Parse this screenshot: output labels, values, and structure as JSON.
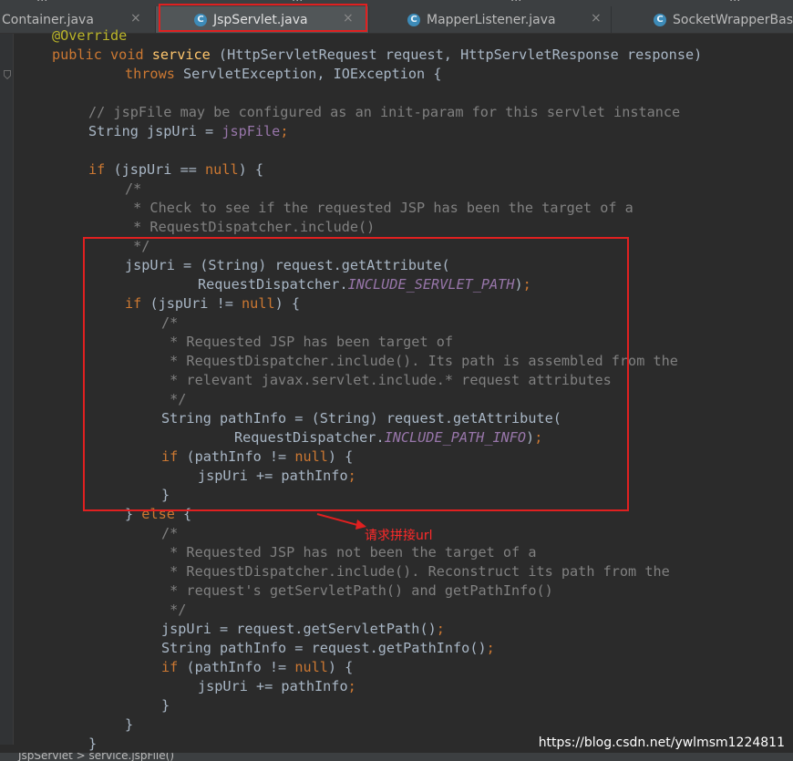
{
  "tabs": [
    {
      "label": "Container.java",
      "active": false
    },
    {
      "label": "JspServlet.java",
      "active": true
    },
    {
      "label": "MapperListener.java",
      "active": false
    },
    {
      "label": "SocketWrapperBase",
      "active": false
    }
  ],
  "tab_icon_letter": "C",
  "close_glyph": "×",
  "ghost_tabs": [
    "...",
    "...",
    "...",
    "..."
  ],
  "code": {
    "l0": {
      "ann": "@Override"
    },
    "l1": {
      "public": "public",
      "void": "void",
      "name": "service",
      "params": " (HttpServletRequest request, HttpServletResponse response)"
    },
    "l2": {
      "throws": "throws",
      "rest": " ServletException, IOException {"
    },
    "l4": {
      "comment": "// jspFile may be configured as an init-param for this servlet instance"
    },
    "l5": {
      "a": "String jspUri = ",
      "field": "jspFile"
    },
    "l7": {
      "if": "if",
      "a": " (jspUri == ",
      "null": "null",
      "b": ") {"
    },
    "l8": {
      "comment": "/*"
    },
    "l9": {
      "comment": " * Check to see if the requested JSP has been the target of a"
    },
    "l10": {
      "comment": " * RequestDispatcher.include()"
    },
    "l11": {
      "comment": " */"
    },
    "l12": {
      "a": "jspUri = (String) request.getAttribute("
    },
    "l13": {
      "a": "RequestDispatcher.",
      "const": "INCLUDE_SERVLET_PATH",
      "b": ")"
    },
    "l14": {
      "if": "if",
      "a": " (jspUri != ",
      "null": "null",
      "b": ") {"
    },
    "l15": {
      "comment": "/*"
    },
    "l16": {
      "comment": " * Requested JSP has been target of"
    },
    "l17": {
      "comment": " * RequestDispatcher.include(). Its path is assembled from the"
    },
    "l18": {
      "comment": " * relevant javax.servlet.include.* request attributes"
    },
    "l19": {
      "comment": " */"
    },
    "l20": {
      "a": "String pathInfo = (String) request.getAttribute("
    },
    "l21": {
      "a": "RequestDispatcher.",
      "const": "INCLUDE_PATH_INFO",
      "b": ")"
    },
    "l22": {
      "if": "if",
      "a": " (pathInfo != ",
      "null": "null",
      "b": ") {"
    },
    "l23": {
      "a": "jspUri += pathInfo"
    },
    "l24": {
      "a": "}"
    },
    "l25": {
      "a": "} ",
      "else": "else",
      "b": " {"
    },
    "l26": {
      "comment": "/*"
    },
    "l27": {
      "comment": " * Requested JSP has not been the target of a"
    },
    "l28": {
      "comment": " * RequestDispatcher.include(). Reconstruct its path from the"
    },
    "l29": {
      "comment": " * request's getServletPath() and getPathInfo()"
    },
    "l30": {
      "comment": " */"
    },
    "l31": {
      "a": "jspUri = request.getServletPath()"
    },
    "l32": {
      "a": "String pathInfo = request.getPathInfo()"
    },
    "l33": {
      "if": "if",
      "a": " (pathInfo != ",
      "null": "null",
      "b": ") {"
    },
    "l34": {
      "a": "jspUri += pathInfo"
    },
    "l35": {
      "a": "}"
    },
    "l36": {
      "a": "}"
    },
    "l37": {
      "a": "}"
    },
    "semicolon": ";"
  },
  "annotation": "请求拼接url",
  "watermark": "https://blog.csdn.net/ywlmsm1224811",
  "breadcrumb": "JspServlet  >  service.jspFile()",
  "colors": {
    "background": "#2b2b2b",
    "keyword": "#cc7832",
    "method": "#ffc66d",
    "comment": "#808080",
    "annotation": "#bbb529",
    "constant": "#9876aa",
    "highlight": "#e02020"
  }
}
